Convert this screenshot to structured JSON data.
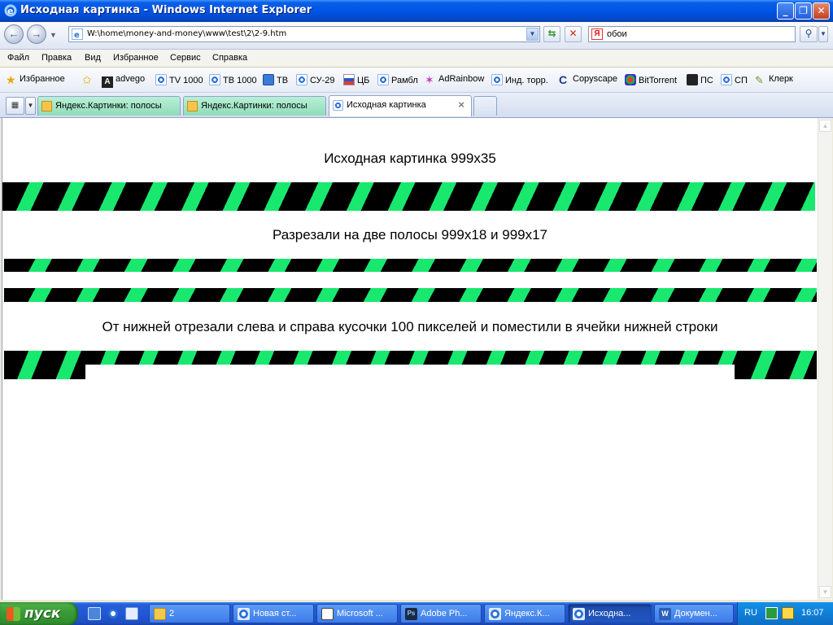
{
  "window": {
    "title": "Исходная картинка - Windows Internet Explorer",
    "minimize_icon": "minimize-icon",
    "maximize_icon": "maximize-icon",
    "close_icon": "close-icon"
  },
  "address": {
    "url": "W:\\home\\money-and-money\\www\\test\\2\\2-9.htm",
    "search_value": "обои"
  },
  "menu": [
    "Файл",
    "Правка",
    "Вид",
    "Избранное",
    "Сервис",
    "Справка"
  ],
  "favorites": {
    "label": "Избранное",
    "items": [
      "advego",
      "TV 1000",
      "ТВ 1000",
      "ТВ",
      "СУ-29",
      "ЦБ",
      "Рамбл",
      "AdRainbow",
      "Инд. торр.",
      "Copyscape",
      "BitTorrent",
      "ПС",
      "СП",
      "Клерк"
    ]
  },
  "tabs": [
    {
      "label": "Яндекс.Картинки: полосы",
      "color": "#8fdcb8"
    },
    {
      "label": "Яндекс.Картинки: полосы",
      "color": "#8fdcb8"
    },
    {
      "label": "Исходная картинка",
      "active": true
    }
  ],
  "content": {
    "heading1": "Исходная картинка 999x35",
    "heading2": "Разрезали на две полосы 999x18 и 999x17",
    "heading3": "От нижней отрезали слева и справа кусочки 100 пикселей и поместили в ячейки нижней строки",
    "stripe_colors": {
      "dark": "#000000",
      "accent": "#19e86f"
    }
  },
  "taskbar": {
    "start_label": "пуск",
    "buttons": [
      "2",
      "Новая ст...",
      "Microsoft ...",
      "Adobe Ph...",
      "Яндекс.К...",
      "Исходна...",
      "Докумен..."
    ],
    "active_button": "Исходна...",
    "lang": "RU",
    "clock": "16:07"
  }
}
